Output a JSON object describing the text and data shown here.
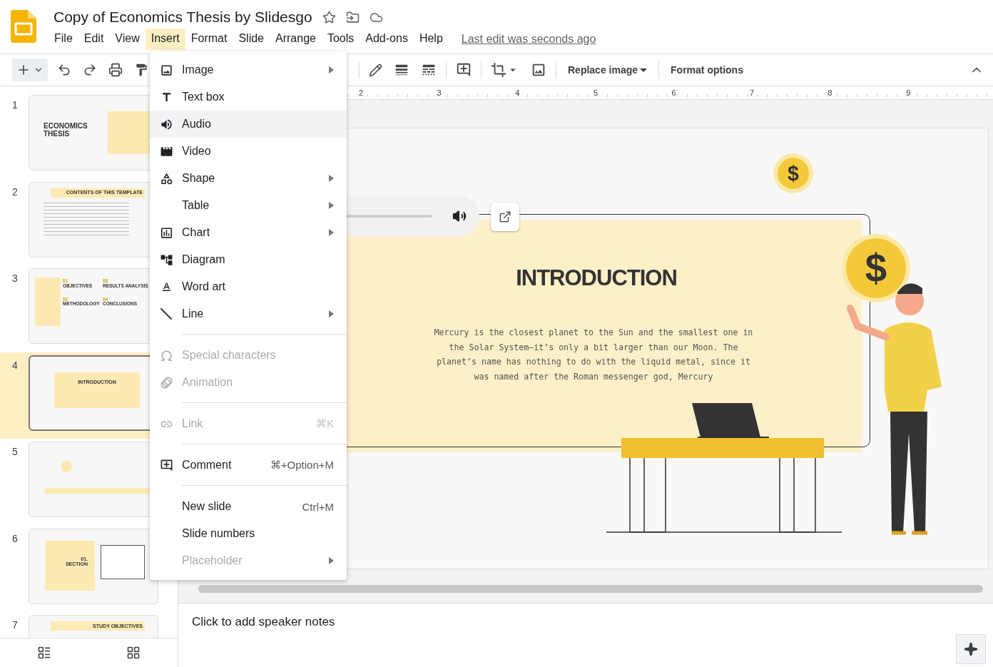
{
  "document": {
    "title": "Copy of Economics Thesis by Slidesgo",
    "last_edit": "Last edit was seconds ago"
  },
  "menu_bar": [
    {
      "label": "File",
      "selected": false
    },
    {
      "label": "Edit",
      "selected": false
    },
    {
      "label": "View",
      "selected": false
    },
    {
      "label": "Insert",
      "selected": true
    },
    {
      "label": "Format",
      "selected": false
    },
    {
      "label": "Slide",
      "selected": false
    },
    {
      "label": "Arrange",
      "selected": false
    },
    {
      "label": "Tools",
      "selected": false
    },
    {
      "label": "Add-ons",
      "selected": false
    },
    {
      "label": "Help",
      "selected": false
    }
  ],
  "toolbar": {
    "replace_image": "Replace image",
    "format_options": "Format options"
  },
  "ruler": [
    "2",
    "3",
    "4",
    "5",
    "6",
    "7",
    "8",
    "9"
  ],
  "slides": [
    {
      "number": "1",
      "selected": false,
      "kind": "cover",
      "texts": [
        "ECONOMICS",
        "THESIS"
      ]
    },
    {
      "number": "2",
      "selected": false,
      "kind": "contents",
      "texts": [
        "CONTENTS OF THIS TEMPLATE"
      ]
    },
    {
      "number": "3",
      "selected": false,
      "kind": "grid",
      "texts": [
        "01",
        "OBJECTIVES",
        "03",
        "RESULTS ANALYSIS",
        "02",
        "METHODOLOGY",
        "04",
        "CONCLUSIONS"
      ]
    },
    {
      "number": "4",
      "selected": true,
      "kind": "intro",
      "texts": [
        "INTRODUCTION"
      ]
    },
    {
      "number": "5",
      "selected": false,
      "kind": "quote"
    },
    {
      "number": "6",
      "selected": false,
      "kind": "section",
      "texts": [
        "01.",
        "SECTION"
      ]
    },
    {
      "number": "7",
      "selected": false,
      "kind": "contents",
      "texts": [
        "STUDY OBJECTIVES"
      ]
    }
  ],
  "slide": {
    "title": "INTRODUCTION",
    "body": "Mercury is the closest planet to the Sun and the smallest one in the Solar System—it’s only a bit larger than our Moon. The planet’s name has nothing to do with the liquid metal, since it was named after the Roman messenger god, Mercury",
    "coins": [
      "$",
      "$"
    ]
  },
  "speaker_notes": {
    "placeholder": "Click to add speaker notes"
  },
  "insert_menu": [
    [
      {
        "label": "Image",
        "submenu": true,
        "disabled": false,
        "highlighted": false
      },
      {
        "label": "Text box",
        "submenu": false,
        "disabled": false,
        "highlighted": false
      },
      {
        "label": "Audio",
        "submenu": false,
        "disabled": false,
        "highlighted": true
      },
      {
        "label": "Video",
        "submenu": false,
        "disabled": false,
        "highlighted": false
      },
      {
        "label": "Shape",
        "submenu": true,
        "disabled": false,
        "highlighted": false
      },
      {
        "label": "Table",
        "submenu": true,
        "disabled": false,
        "highlighted": false
      },
      {
        "label": "Chart",
        "submenu": true,
        "disabled": false,
        "highlighted": false
      },
      {
        "label": "Diagram",
        "submenu": false,
        "disabled": false,
        "highlighted": false
      },
      {
        "label": "Word art",
        "submenu": false,
        "disabled": false,
        "highlighted": false
      },
      {
        "label": "Line",
        "submenu": true,
        "disabled": false,
        "highlighted": false
      }
    ],
    [
      {
        "label": "Special characters",
        "submenu": false,
        "disabled": true,
        "highlighted": false
      },
      {
        "label": "Animation",
        "submenu": false,
        "disabled": true,
        "highlighted": false
      }
    ],
    [
      {
        "label": "Link",
        "shortcut": "⌘K",
        "submenu": false,
        "disabled": true,
        "highlighted": false
      }
    ],
    [
      {
        "label": "Comment",
        "shortcut": "⌘+Option+M",
        "submenu": false,
        "disabled": false,
        "highlighted": false
      }
    ],
    [
      {
        "label": "New slide",
        "shortcut": "Ctrl+M",
        "submenu": false,
        "disabled": false,
        "highlighted": false
      },
      {
        "label": "Slide numbers",
        "submenu": false,
        "disabled": false,
        "highlighted": false
      },
      {
        "label": "Placeholder",
        "submenu": true,
        "disabled": true,
        "highlighted": false
      }
    ]
  ]
}
